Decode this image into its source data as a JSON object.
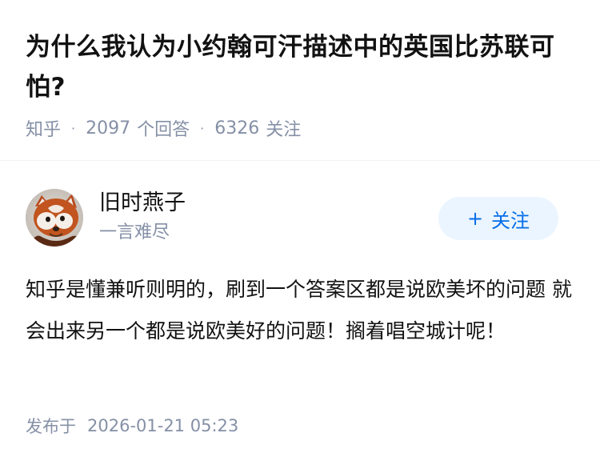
{
  "question": {
    "title": "为什么我认为小约翰可汗描述中的英国比苏联可怕?",
    "source": "知乎",
    "answer_count": "2097",
    "answer_unit": "个回答",
    "follower_count": "6326",
    "follower_unit": "关注"
  },
  "answer": {
    "author": {
      "name": "旧时燕子",
      "headline": "一言难尽",
      "avatar_icon": "red-panda-avatar"
    },
    "follow_button": {
      "icon": "plus-icon",
      "label": "关注"
    },
    "content": "知乎是懂兼听则明的，刷到一个答案区都是说欧美坏的问题 就会出来另一个都是说欧美好的问题！搁着唱空城计呢！",
    "publish_label": "发布于",
    "publish_time": "2026-01-21 05:23"
  },
  "colors": {
    "text_primary": "#121212",
    "text_secondary": "#8590a6",
    "brand_blue": "#056de8",
    "follow_bg": "#ebf5ff"
  }
}
